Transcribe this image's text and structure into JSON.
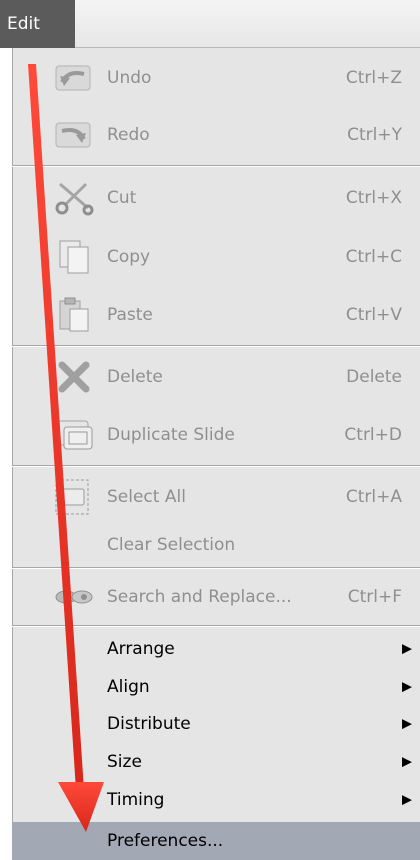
{
  "menubar": {
    "active_menu": "Edit"
  },
  "menu": {
    "items": [
      {
        "label": "Undo",
        "shortcut": "Ctrl+Z",
        "icon": "undo-icon",
        "enabled": false
      },
      {
        "label": "Redo",
        "shortcut": "Ctrl+Y",
        "icon": "redo-icon",
        "enabled": false
      },
      {
        "label": "Cut",
        "shortcut": "Ctrl+X",
        "icon": "cut-icon",
        "enabled": false
      },
      {
        "label": "Copy",
        "shortcut": "Ctrl+C",
        "icon": "copy-icon",
        "enabled": false
      },
      {
        "label": "Paste",
        "shortcut": "Ctrl+V",
        "icon": "paste-icon",
        "enabled": false
      },
      {
        "label": "Delete",
        "shortcut": "Delete",
        "icon": "delete-icon",
        "enabled": false
      },
      {
        "label": "Duplicate Slide",
        "shortcut": "Ctrl+D",
        "icon": "duplicate-slide-icon",
        "enabled": false
      },
      {
        "label": "Select All",
        "shortcut": "Ctrl+A",
        "icon": "select-all-icon",
        "enabled": false
      },
      {
        "label": "Clear Selection",
        "shortcut": "",
        "icon": "",
        "enabled": false
      },
      {
        "label": "Search and Replace...",
        "shortcut": "Ctrl+F",
        "icon": "search-replace-icon",
        "enabled": false
      },
      {
        "label": "Arrange",
        "submenu": true,
        "enabled": true
      },
      {
        "label": "Align",
        "submenu": true,
        "enabled": true
      },
      {
        "label": "Distribute",
        "submenu": true,
        "enabled": true
      },
      {
        "label": "Size",
        "submenu": true,
        "enabled": true
      },
      {
        "label": "Timing",
        "submenu": true,
        "enabled": true
      },
      {
        "label": "Preferences...",
        "enabled": true,
        "highlighted": true
      }
    ]
  },
  "annotation": {
    "arrow_color": "#e53935"
  },
  "colors": {
    "menu_background": "#e5e5e5",
    "highlight": "#a2a8b4",
    "disabled_text": "#8f8f8f",
    "active_menu_background": "#5b5b5b"
  }
}
